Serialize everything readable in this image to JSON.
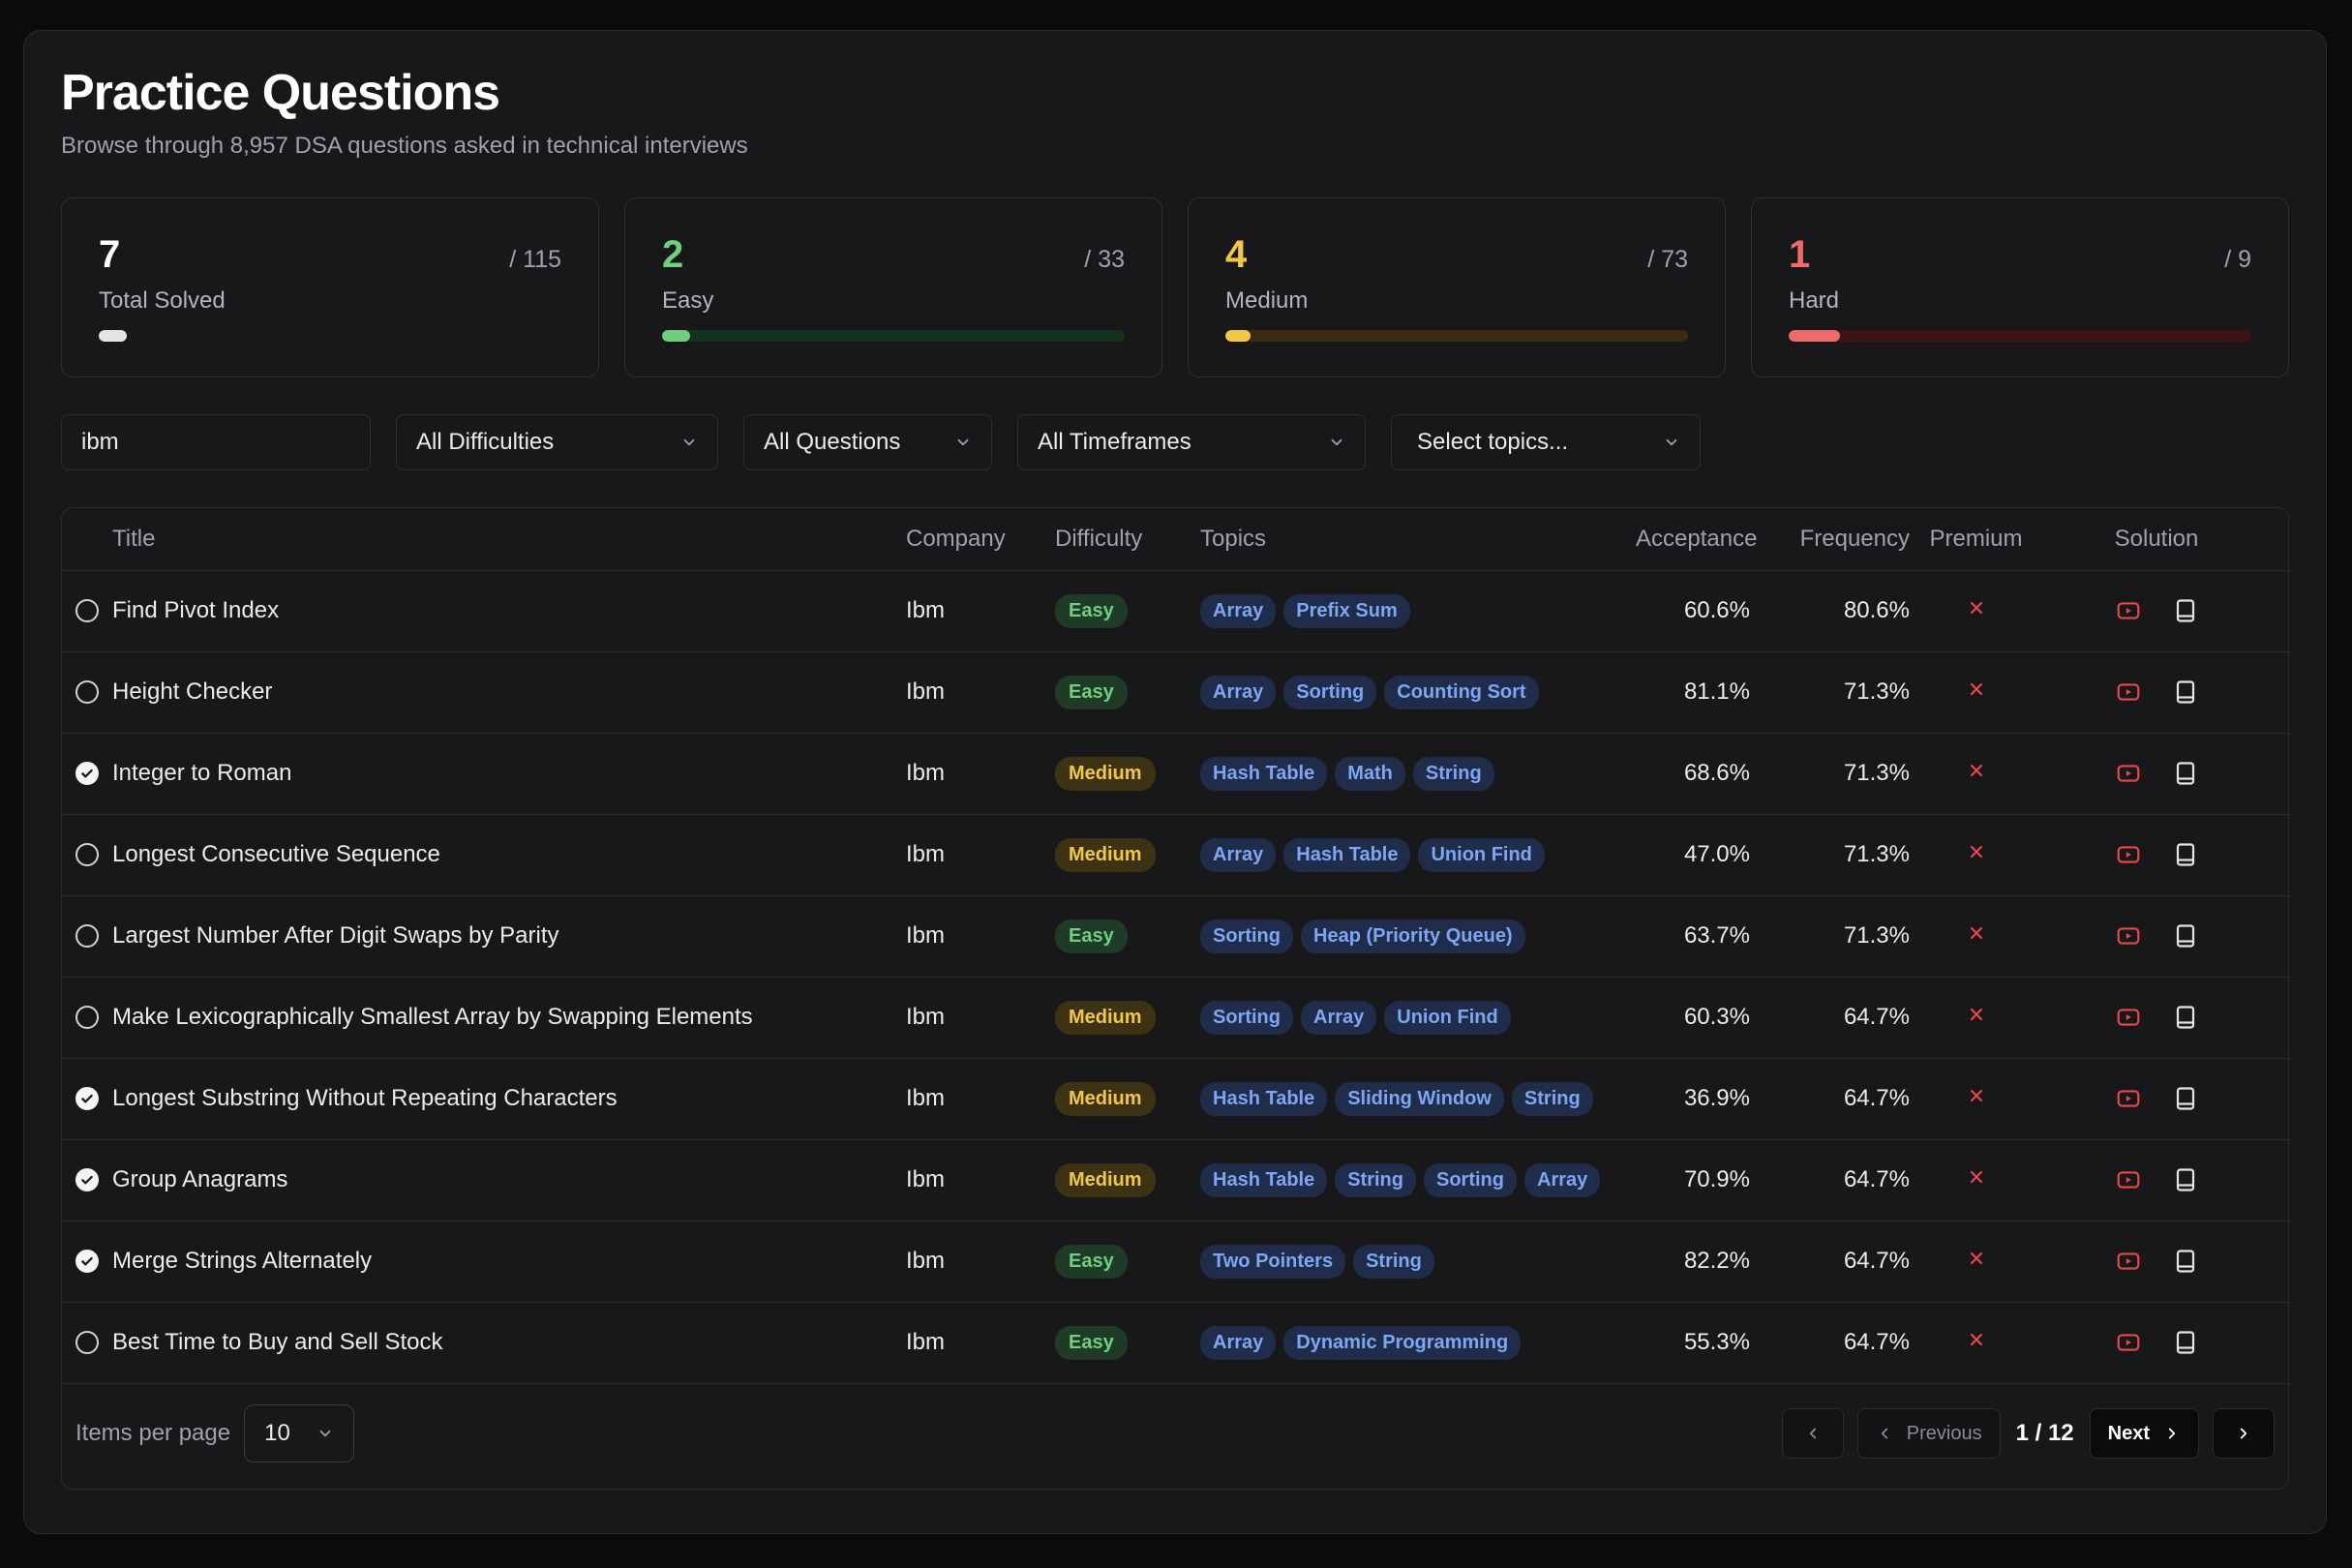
{
  "header": {
    "title": "Practice Questions",
    "subtitle": "Browse through 8,957 DSA questions asked in technical interviews"
  },
  "stats": [
    {
      "value": "7",
      "total": "/ 115",
      "label": "Total Solved",
      "color": "#ffffff",
      "track": "#18181b",
      "fill": "#e4e4e7",
      "progress": 0.06
    },
    {
      "value": "2",
      "total": "/ 33",
      "label": "Easy",
      "color": "#6fcf7f",
      "track": "#14321d",
      "fill": "#6fcf7f",
      "progress": 0.06
    },
    {
      "value": "4",
      "total": "/ 73",
      "label": "Medium",
      "color": "#f2c744",
      "track": "#3a2a10",
      "fill": "#f2c744",
      "progress": 0.055
    },
    {
      "value": "1",
      "total": "/ 9",
      "label": "Hard",
      "color": "#ef6b6b",
      "track": "#3c1416",
      "fill": "#ef6b6b",
      "progress": 0.11
    }
  ],
  "filters": {
    "search_value": "ibm",
    "difficulty": "All Difficulties",
    "questions": "All Questions",
    "timeframe": "All Timeframes",
    "topics": "Select topics..."
  },
  "table": {
    "headers": {
      "title": "Title",
      "company": "Company",
      "difficulty": "Difficulty",
      "topics": "Topics",
      "acceptance": "Acceptance",
      "frequency": "Frequency",
      "premium": "Premium",
      "solution": "Solution"
    },
    "rows": [
      {
        "title": "Find Pivot Index",
        "checked": false,
        "company": "Ibm",
        "difficulty": "Easy",
        "topics": [
          "Array",
          "Prefix Sum"
        ],
        "acceptance": "60.6%",
        "frequency": "80.6%"
      },
      {
        "title": "Height Checker",
        "checked": false,
        "company": "Ibm",
        "difficulty": "Easy",
        "topics": [
          "Array",
          "Sorting",
          "Counting Sort"
        ],
        "acceptance": "81.1%",
        "frequency": "71.3%"
      },
      {
        "title": "Integer to Roman",
        "checked": true,
        "company": "Ibm",
        "difficulty": "Medium",
        "topics": [
          "Hash Table",
          "Math",
          "String"
        ],
        "acceptance": "68.6%",
        "frequency": "71.3%"
      },
      {
        "title": "Longest Consecutive Sequence",
        "checked": false,
        "company": "Ibm",
        "difficulty": "Medium",
        "topics": [
          "Array",
          "Hash Table",
          "Union Find"
        ],
        "acceptance": "47.0%",
        "frequency": "71.3%"
      },
      {
        "title": "Largest Number After Digit Swaps by Parity",
        "checked": false,
        "company": "Ibm",
        "difficulty": "Easy",
        "topics": [
          "Sorting",
          "Heap (Priority Queue)"
        ],
        "acceptance": "63.7%",
        "frequency": "71.3%"
      },
      {
        "title": "Make Lexicographically Smallest Array by Swapping Elements",
        "checked": false,
        "company": "Ibm",
        "difficulty": "Medium",
        "topics": [
          "Sorting",
          "Array",
          "Union Find"
        ],
        "acceptance": "60.3%",
        "frequency": "64.7%"
      },
      {
        "title": "Longest Substring Without Repeating Characters",
        "checked": true,
        "company": "Ibm",
        "difficulty": "Medium",
        "topics": [
          "Hash Table",
          "Sliding Window",
          "String"
        ],
        "acceptance": "36.9%",
        "frequency": "64.7%"
      },
      {
        "title": "Group Anagrams",
        "checked": true,
        "company": "Ibm",
        "difficulty": "Medium",
        "topics": [
          "Hash Table",
          "String",
          "Sorting",
          "Array"
        ],
        "acceptance": "70.9%",
        "frequency": "64.7%"
      },
      {
        "title": "Merge Strings Alternately",
        "checked": true,
        "company": "Ibm",
        "difficulty": "Easy",
        "topics": [
          "Two Pointers",
          "String"
        ],
        "acceptance": "82.2%",
        "frequency": "64.7%"
      },
      {
        "title": "Best Time to Buy and Sell Stock",
        "checked": false,
        "company": "Ibm",
        "difficulty": "Easy",
        "topics": [
          "Array",
          "Dynamic Programming"
        ],
        "acceptance": "55.3%",
        "frequency": "64.7%"
      }
    ]
  },
  "pagination": {
    "items_label": "Items per page",
    "items_value": "10",
    "previous_label": "Previous",
    "page_indicator": "1 / 12",
    "next_label": "Next"
  },
  "colors": {
    "accent_red": "#e5484d",
    "easy": "#6fcf7f",
    "medium": "#f2c744",
    "hard": "#ef6b6b",
    "topic": "#7fa6f2"
  }
}
